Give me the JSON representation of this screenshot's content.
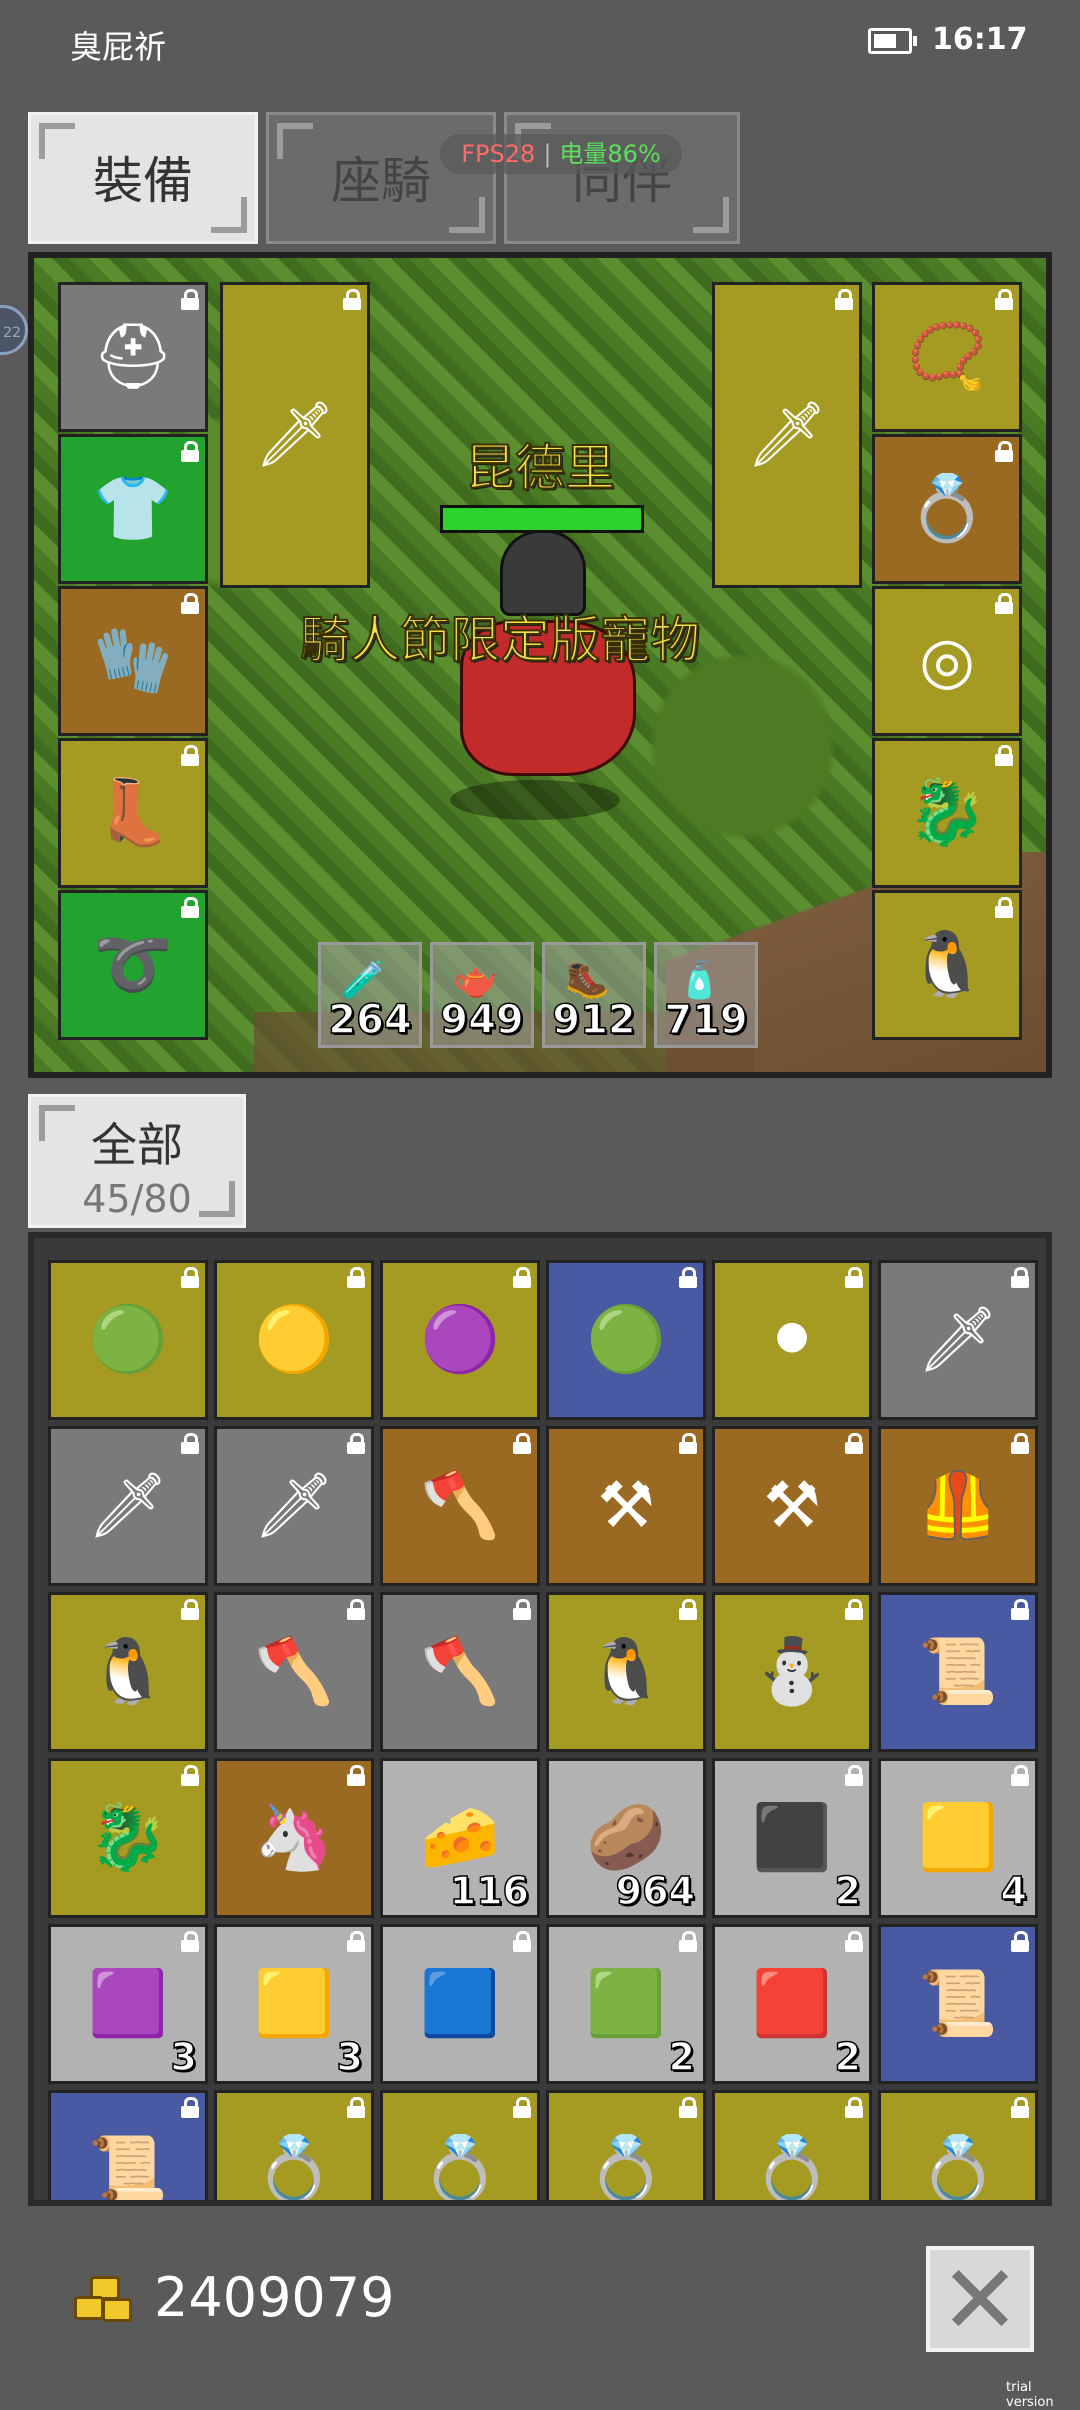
{
  "status_bar": {
    "carrier": "臭屁祈",
    "time": "16:17"
  },
  "tabs": [
    {
      "label": "裝備",
      "active": true
    },
    {
      "label": "座騎",
      "active": false
    },
    {
      "label": "同伴",
      "active": false
    }
  ],
  "overlay": {
    "fps": "FPS28",
    "battery": "电量86%"
  },
  "side_handle": "22",
  "game_view": {
    "character_name": "昆德里",
    "character_title": "騎人節限定版寵物",
    "hp_fraction": 1.0,
    "left_slots": [
      {
        "name": "helmet",
        "icon": "⛑",
        "color": "#7a7a7a"
      },
      {
        "name": "armor",
        "icon": "👕",
        "color": "#22a22e"
      },
      {
        "name": "gloves",
        "icon": "🧤",
        "color": "#9a6a22"
      },
      {
        "name": "boots",
        "icon": "👢",
        "color": "#a59a22"
      },
      {
        "name": "belt",
        "icon": "➰",
        "color": "#22a22e"
      }
    ],
    "weapon_left": {
      "icon": "🗡",
      "color": "#a59a22"
    },
    "weapon_right": {
      "icon": "🗡",
      "color": "#a59a22"
    },
    "right_slots": [
      {
        "name": "amulet",
        "icon": "📿",
        "color": "#a59a22"
      },
      {
        "name": "ring",
        "icon": "💍",
        "color": "#9a6a22"
      },
      {
        "name": "ring-2",
        "icon": "◎",
        "color": "#a59a22"
      },
      {
        "name": "mount-card",
        "icon": "🐉",
        "color": "#a59a22"
      },
      {
        "name": "pet-card",
        "icon": "🐧",
        "color": "#a59a22"
      }
    ],
    "potions": [
      {
        "icon": "🧪",
        "count": "264"
      },
      {
        "icon": "🫖",
        "count": "949"
      },
      {
        "icon": "🥾",
        "count": "912"
      },
      {
        "icon": "🧴",
        "count": "719"
      }
    ]
  },
  "inventory_tab": {
    "label": "全部",
    "count": "45/80"
  },
  "inventory": [
    {
      "icon": "🟢",
      "color": "#a59a22",
      "qty": ""
    },
    {
      "icon": "🟡",
      "color": "#a59a22",
      "qty": ""
    },
    {
      "icon": "🟣",
      "color": "#a59a22",
      "qty": ""
    },
    {
      "icon": "🟢",
      "color": "#4a5aa2",
      "qty": ""
    },
    {
      "icon": "⚫",
      "color": "#a59a22",
      "qty": ""
    },
    {
      "icon": "🗡",
      "color": "#7a7a7a",
      "qty": ""
    },
    {
      "icon": "🗡",
      "color": "#7a7a7a",
      "qty": ""
    },
    {
      "icon": "🗡",
      "color": "#7a7a7a",
      "qty": ""
    },
    {
      "icon": "🪓",
      "color": "#9a6a22",
      "qty": ""
    },
    {
      "icon": "⚒",
      "color": "#9a6a22",
      "qty": ""
    },
    {
      "icon": "⚒",
      "color": "#9a6a22",
      "qty": ""
    },
    {
      "icon": "🦺",
      "color": "#9a6a22",
      "qty": ""
    },
    {
      "icon": "🐧",
      "color": "#a59a22",
      "qty": ""
    },
    {
      "icon": "🪓",
      "color": "#7a7a7a",
      "qty": ""
    },
    {
      "icon": "🪓",
      "color": "#7a7a7a",
      "qty": ""
    },
    {
      "icon": "🐧",
      "color": "#a59a22",
      "qty": ""
    },
    {
      "icon": "⛄",
      "color": "#a59a22",
      "qty": ""
    },
    {
      "icon": "📜",
      "color": "#4a5aa2",
      "qty": ""
    },
    {
      "icon": "🐉",
      "color": "#a59a22",
      "qty": ""
    },
    {
      "icon": "🦄",
      "color": "#9a6a22",
      "qty": ""
    },
    {
      "icon": "🧀",
      "color": "#b2b2b2",
      "qty": "116"
    },
    {
      "icon": "🥔",
      "color": "#b2b2b2",
      "qty": "964"
    },
    {
      "icon": "⬛",
      "color": "#b2b2b2",
      "qty": "2"
    },
    {
      "icon": "🟨",
      "color": "#b2b2b2",
      "qty": "4"
    },
    {
      "icon": "🟪",
      "color": "#b2b2b2",
      "qty": "3"
    },
    {
      "icon": "🟨",
      "color": "#b2b2b2",
      "qty": "3"
    },
    {
      "icon": "🟦",
      "color": "#b2b2b2",
      "qty": ""
    },
    {
      "icon": "🟩",
      "color": "#b2b2b2",
      "qty": "2"
    },
    {
      "icon": "🟥",
      "color": "#b2b2b2",
      "qty": "2"
    },
    {
      "icon": "📜",
      "color": "#4a5aa2",
      "qty": ""
    },
    {
      "icon": "📜",
      "color": "#4a5aa2",
      "qty": ""
    },
    {
      "icon": "💍",
      "color": "#a59a22",
      "qty": ""
    },
    {
      "icon": "💍",
      "color": "#a59a22",
      "qty": ""
    },
    {
      "icon": "💍",
      "color": "#a59a22",
      "qty": ""
    },
    {
      "icon": "💍",
      "color": "#a59a22",
      "qty": ""
    },
    {
      "icon": "💍",
      "color": "#a59a22",
      "qty": ""
    }
  ],
  "gold": "2409079",
  "watermark": "trial version"
}
